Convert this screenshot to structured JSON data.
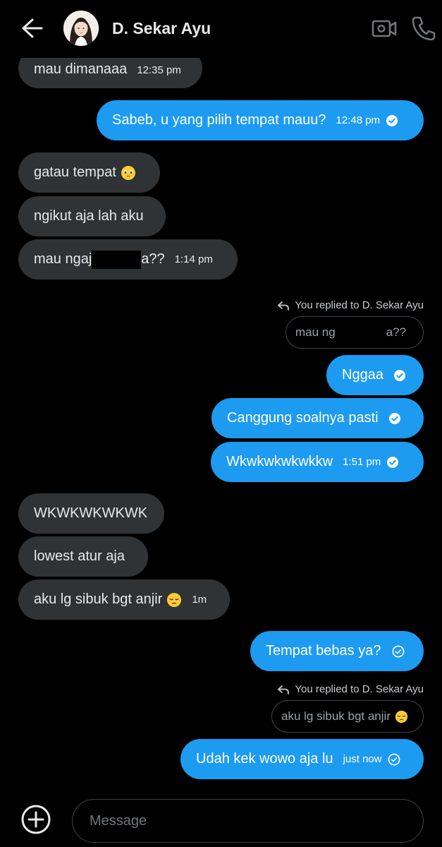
{
  "header": {
    "contact_name": "D. Sekar Ayu"
  },
  "messages": [
    {
      "side": "in",
      "text": "mau dimanaaa",
      "time": "12:35 pm"
    },
    {
      "side": "out",
      "text": "Sabeb, u yang pilih tempat mauu?",
      "time": "12:48 pm",
      "status": "seen"
    },
    {
      "side": "in",
      "text": "gatau tempat",
      "emoji": "pleading-face"
    },
    {
      "side": "in",
      "text": "ngikut aja lah aku"
    },
    {
      "side": "in",
      "text_start": "mau ngaj",
      "text_end": "a??",
      "time": "1:14 pm",
      "partially_obscured": true
    },
    {
      "side": "out",
      "text": "Nggaa",
      "status": "seen"
    },
    {
      "side": "out",
      "text": "Canggung soalnya pasti",
      "status": "seen"
    },
    {
      "side": "out",
      "text": "Wkwkwkwkwkkw",
      "time": "1:51 pm",
      "status": "seen"
    },
    {
      "side": "in",
      "text": "WKWKWKWKWK"
    },
    {
      "side": "in",
      "text": "lowest atur aja"
    },
    {
      "side": "in",
      "text": "aku lg sibuk bgt anjir",
      "emoji": "pensive-face",
      "time": "1m"
    },
    {
      "side": "out",
      "text": "Tempat bebas ya?",
      "status": "sent"
    },
    {
      "side": "out",
      "text": "Udah kek wowo aja lu",
      "time": "just now",
      "status": "sent"
    }
  ],
  "replies": [
    {
      "label": "You replied to D. Sekar Ayu",
      "quote_start": "mau ng",
      "quote_end": "a??"
    },
    {
      "label": "You replied to D. Sekar Ayu",
      "quote": "aku lg sibuk bgt anjir",
      "emoji": "pensive-face"
    }
  ],
  "composer": {
    "placeholder": "Message"
  },
  "colors": {
    "background": "#000000",
    "incoming_bubble": "#2f3336",
    "outgoing_bubble": "#1d9bf0",
    "text": "#e7e9ea"
  }
}
